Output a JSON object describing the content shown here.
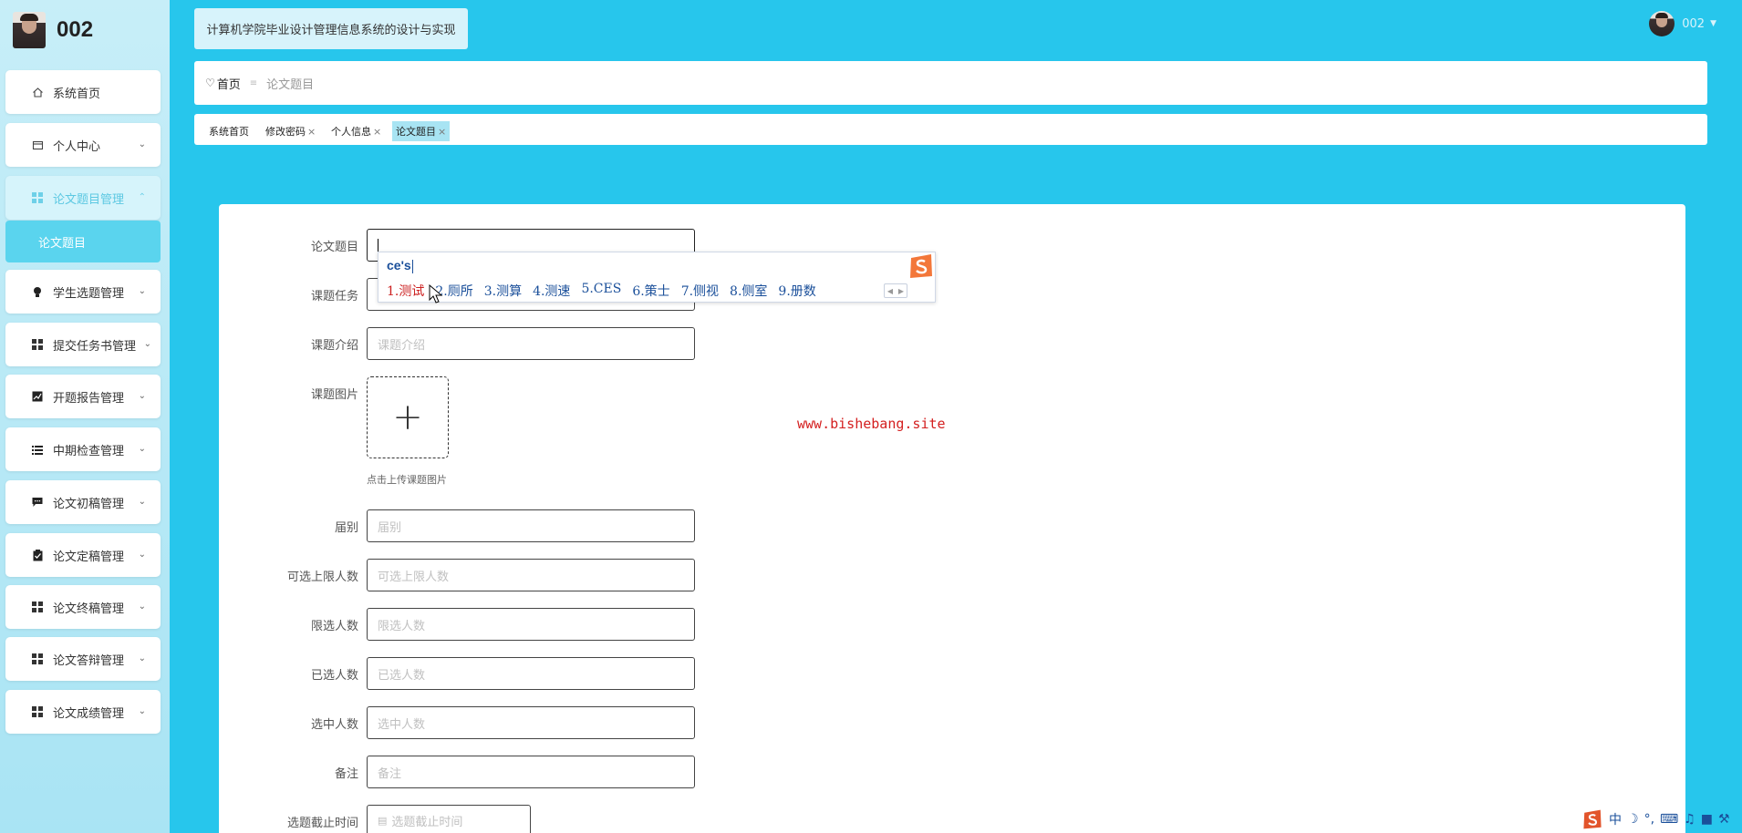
{
  "sidebar": {
    "brand_name": "002",
    "items": [
      {
        "label": "系统首页",
        "icon": "home-icon"
      },
      {
        "label": "个人中心",
        "icon": "card-icon"
      },
      {
        "label": "论文题目管理",
        "icon": "grid-icon"
      },
      {
        "label": "学生选题管理",
        "icon": "bulb-icon"
      },
      {
        "label": "提交任务书管理",
        "icon": "grid-icon"
      },
      {
        "label": "开题报告管理",
        "icon": "chart-icon"
      },
      {
        "label": "中期检查管理",
        "icon": "list-icon"
      },
      {
        "label": "论文初稿管理",
        "icon": "chat-icon"
      },
      {
        "label": "论文定稿管理",
        "icon": "clipboard-icon"
      },
      {
        "label": "论文终稿管理",
        "icon": "grid-icon"
      },
      {
        "label": "论文答辩管理",
        "icon": "grid-icon"
      },
      {
        "label": "论文成绩管理",
        "icon": "grid-icon"
      }
    ],
    "submenu_label": "论文题目"
  },
  "header": {
    "system_title": "计算机学院毕业设计管理信息系统的设计与实现",
    "username": "002"
  },
  "breadcrumb": {
    "home": "首页",
    "current": "论文题目"
  },
  "tabs": [
    {
      "label": "系统首页",
      "closable": false
    },
    {
      "label": "修改密码",
      "closable": true
    },
    {
      "label": "个人信息",
      "closable": true
    },
    {
      "label": "论文题目",
      "closable": true,
      "active": true
    }
  ],
  "form": {
    "fields": {
      "title": {
        "label": "论文题目",
        "value": "",
        "placeholder": ""
      },
      "task": {
        "label": "课题任务",
        "placeholder": ""
      },
      "intro": {
        "label": "课题介绍",
        "placeholder": "课题介绍"
      },
      "image": {
        "label": "课题图片",
        "hint": "点击上传课题图片"
      },
      "session": {
        "label": "届别",
        "placeholder": "届别"
      },
      "max_selectable": {
        "label": "可选上限人数",
        "placeholder": "可选上限人数"
      },
      "limit": {
        "label": "限选人数",
        "placeholder": "限选人数"
      },
      "selected": {
        "label": "已选人数",
        "placeholder": "已选人数"
      },
      "chosen": {
        "label": "选中人数",
        "placeholder": "选中人数"
      },
      "remark": {
        "label": "备注",
        "placeholder": "备注"
      },
      "deadline": {
        "label": "选题截止时间",
        "placeholder": "选题截止时间"
      }
    }
  },
  "watermark": "www.bishebang.site",
  "ime": {
    "composition": "ce's",
    "candidates": [
      "1.测试",
      "2.厕所",
      "3.测算",
      "4.测速",
      "5.CES",
      "6.策士",
      "7.侧视",
      "8.侧室",
      "9.册数"
    ]
  },
  "tray": {
    "lang": "中"
  },
  "colors": {
    "accent": "#27c6ec",
    "sidebar_bg": "#b8e8f6",
    "active_menu_text": "#5cc8e2",
    "submenu_bg": "#5ad4ee",
    "watermark": "#d42020",
    "ime_text": "#1a4f9a"
  }
}
